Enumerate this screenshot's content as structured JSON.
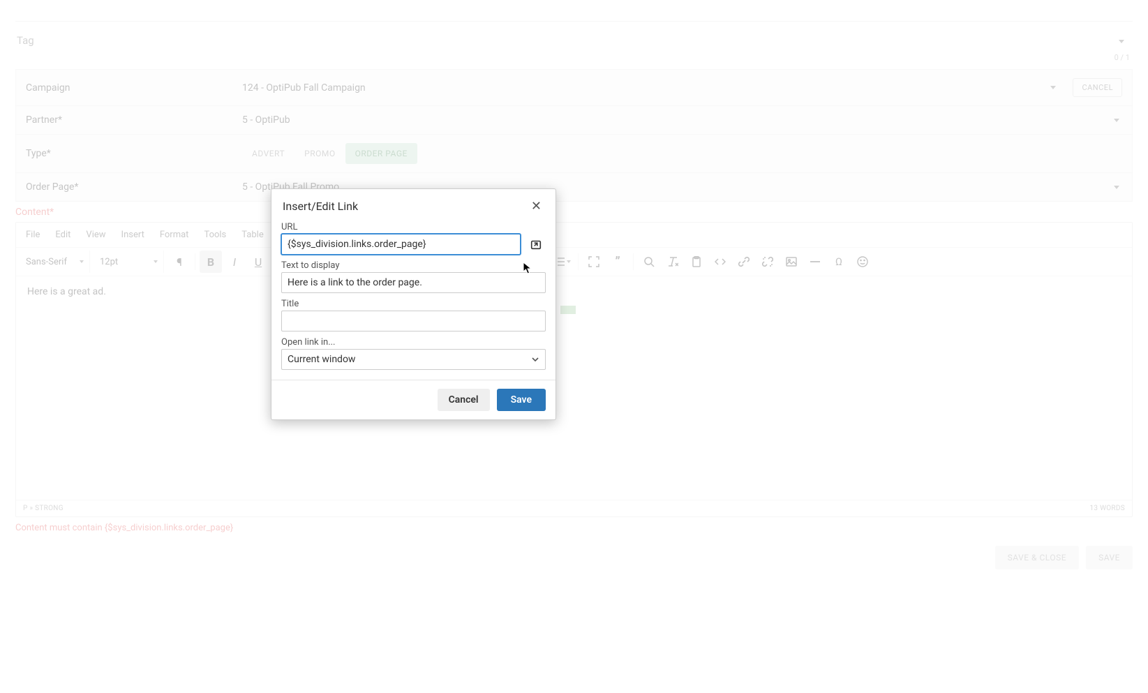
{
  "tag": {
    "label": "Tag",
    "counter": "0 / 1"
  },
  "form": {
    "campaign": {
      "label": "Campaign",
      "value": "124 - OptiPub Fall Campaign",
      "cancel": "CANCEL"
    },
    "partner": {
      "label": "Partner*",
      "value": "5 - OptiPub"
    },
    "type": {
      "label": "Type*",
      "tabs": [
        "ADVERT",
        "PROMO",
        "ORDER PAGE"
      ],
      "active": 2
    },
    "orderpage": {
      "label": "Order Page*",
      "value": "5 - OptiPub Fall Promo"
    }
  },
  "content_label": "Content*",
  "editor": {
    "menu": [
      "File",
      "Edit",
      "View",
      "Insert",
      "Format",
      "Tools",
      "Table"
    ],
    "font": "Sans-Serif",
    "size": "12pt",
    "body": "Here is a great ad.",
    "path": "P » STRONG",
    "words": "13 WORDS"
  },
  "validation": "Content must contain {$sys_division.links.order_page}",
  "page_buttons": {
    "save_close": "SAVE & CLOSE",
    "save": "SAVE"
  },
  "modal": {
    "title": "Insert/Edit Link",
    "url_label": "URL",
    "url_value": "{$sys_division.links.order_page}",
    "text_label": "Text to display",
    "text_value": "Here is a link to the order page.",
    "title_label": "Title",
    "title_value": "",
    "openin_label": "Open link in...",
    "openin_value": "Current window",
    "cancel": "Cancel",
    "save": "Save"
  }
}
